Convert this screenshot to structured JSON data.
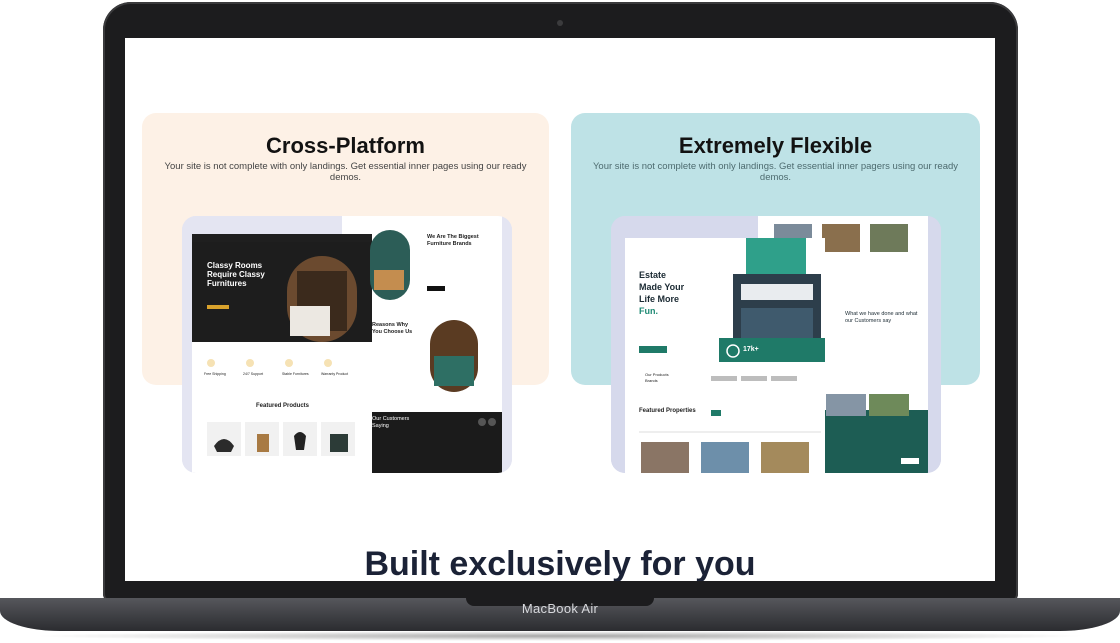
{
  "device": {
    "label": "MacBook Air"
  },
  "cards": [
    {
      "title": "Cross-Platform",
      "description": "Your site is not complete with only landings. Get essential inner pages using our ready demos.",
      "mock": {
        "hero_title": "Classy Rooms Require Classy Furnitures",
        "brands_title": "We Are The Biggest Furniture Brands",
        "reasons_title": "Reasons Why You Choose Us",
        "features": [
          "Free Shipping",
          "24/7 Support",
          "Stable Fornitures",
          "Warranty Product"
        ],
        "featured_title": "Featured Products",
        "customers_title": "Our Customers Saying"
      }
    },
    {
      "title": "Extremely Flexible",
      "description": "Your site is not complete with only landings. Get essential inner pagers using our ready demos.",
      "mock": {
        "hero_line1": "Estate",
        "hero_line2": "Made Your",
        "hero_line3": "Life More",
        "hero_accent": "Fun.",
        "stat": "17k+",
        "partners_label": "Our Products Brands",
        "featured_title": "Featured Properties",
        "what_title": "What we have done and what our Customers say"
      }
    }
  ],
  "footer_heading": "Built exclusively for you",
  "colors": {
    "peach": "#fdf1e6",
    "teal_bg": "#bee2e6",
    "accent_teal": "#167a6a",
    "gold": "#d9a22c",
    "dark": "#1a1a1a"
  }
}
